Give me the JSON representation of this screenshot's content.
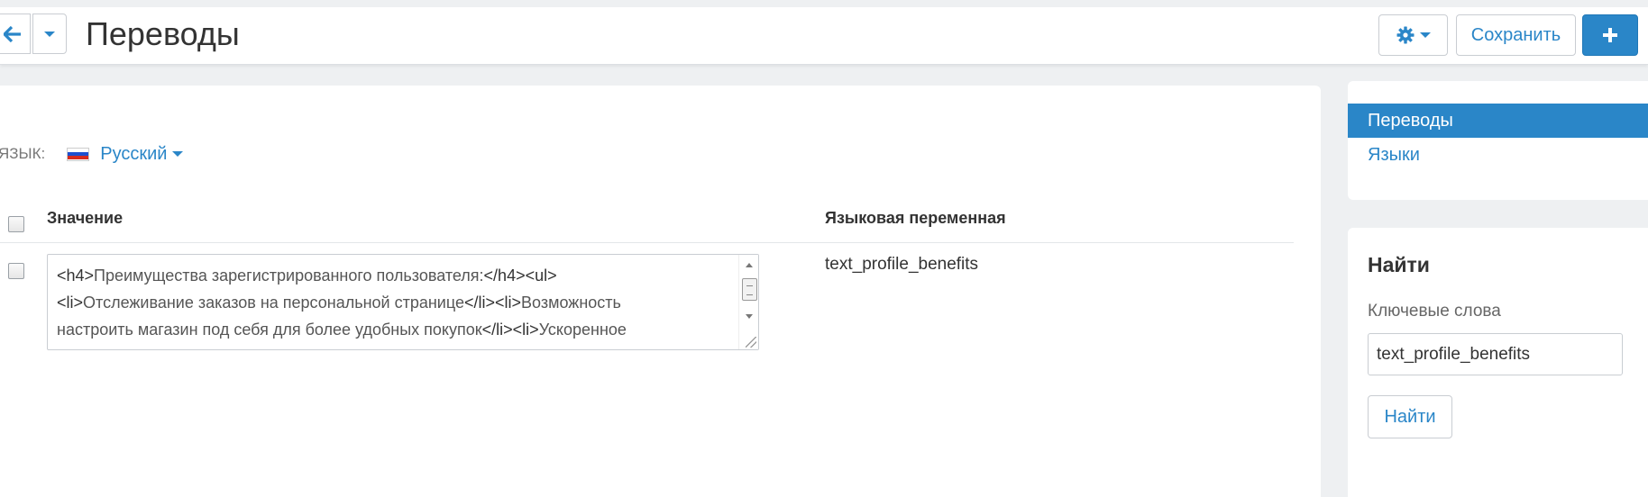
{
  "header": {
    "title": "Переводы",
    "save_label": "Сохранить",
    "back_icon": "arrow-left-icon",
    "history_icon": "caret-down-icon",
    "settings_icon": "gear-icon",
    "add_icon": "plus-icon"
  },
  "language": {
    "label": "ЯЗЫК:",
    "selected": "Русский",
    "flag": "russian-flag-icon"
  },
  "table": {
    "columns": [
      "Значение",
      "Языковая переменная"
    ],
    "rows": [
      {
        "value_lines": [
          "<h4>Преимущества зарегистрированного пользователя:</h4><ul>",
          "<li>Отслеживание заказов на персональной странице</li><li>Возможность",
          "настроить магазин под себя для более удобных покупок</li><li>Ускоренное"
        ],
        "variable": "text_profile_benefits"
      }
    ]
  },
  "sidebar": {
    "items": [
      {
        "label": "Переводы",
        "active": true
      },
      {
        "label": "Языки",
        "active": false
      }
    ]
  },
  "search": {
    "title": "Найти",
    "keywords_label": "Ключевые слова",
    "keywords_value": "text_profile_benefits",
    "button_label": "Найти"
  },
  "colors": {
    "accent": "#2a86c8",
    "background": "#eef0f2"
  }
}
